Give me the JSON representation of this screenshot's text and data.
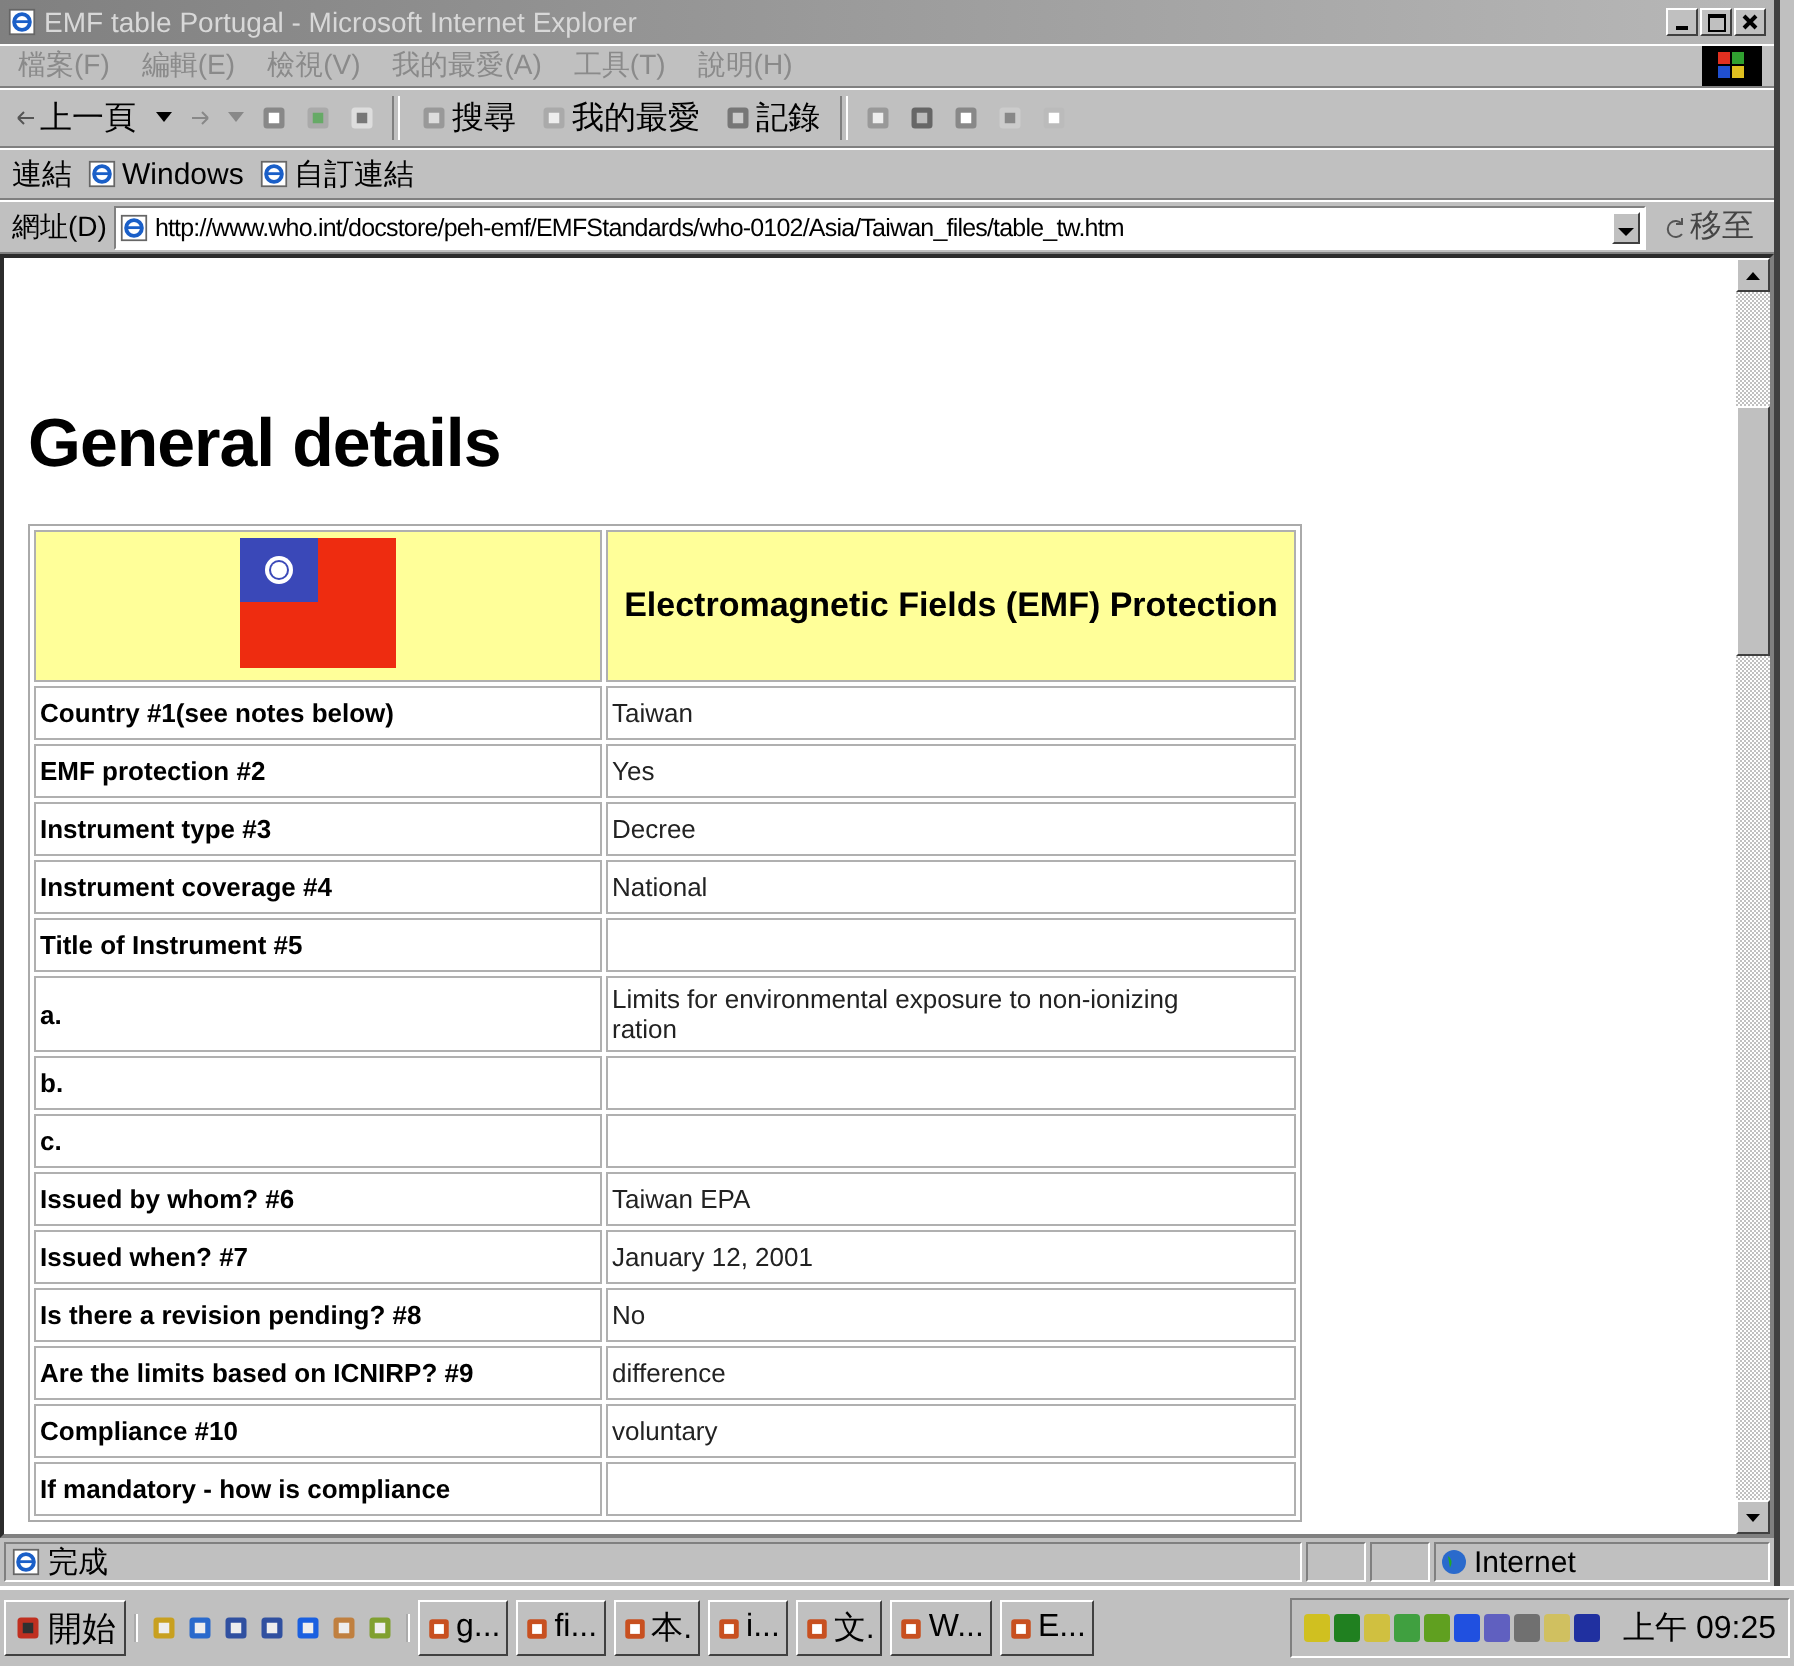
{
  "window": {
    "title": "EMF table Portugal - Microsoft Internet Explorer"
  },
  "menu": [
    "檔案(F)",
    "編輯(E)",
    "檢視(V)",
    "我的最愛(A)",
    "工具(T)",
    "說明(H)"
  ],
  "toolbar": {
    "back": "上一頁",
    "search": "搜尋",
    "favorites": "我的最愛",
    "history": "記錄"
  },
  "links_bar": {
    "label": "連結",
    "links": [
      "Windows",
      "自訂連結"
    ]
  },
  "address_bar": {
    "label": "網址(D)",
    "value": "http://www.who.int/docstore/peh-emf/EMFStandards/who-0102/Asia/Taiwan_files/table_tw.htm",
    "go": "移至"
  },
  "page": {
    "heading": "General details",
    "table_header": "Electromagnetic Fields (EMF) Protection",
    "rows": [
      {
        "label": "Country #1(see notes below)",
        "value": "Taiwan"
      },
      {
        "label": "EMF protection #2",
        "value": "Yes"
      },
      {
        "label": "Instrument type #3",
        "value": "Decree"
      },
      {
        "label": "Instrument coverage #4",
        "value": "National"
      },
      {
        "label": "Title of Instrument #5",
        "value": ""
      },
      {
        "label": "a.",
        "value": "Limits for environmental exposure to non-ionizing ration"
      },
      {
        "label": "b.",
        "value": ""
      },
      {
        "label": "c.",
        "value": ""
      },
      {
        "label": "Issued by whom? #6",
        "value": "Taiwan EPA"
      },
      {
        "label": "Issued when? #7",
        "value": "January 12, 2001"
      },
      {
        "label": "Is there a revision pending? #8",
        "value": "No"
      },
      {
        "label": "Are the limits based on ICNIRP? #9",
        "value": "difference"
      },
      {
        "label": "Compliance #10",
        "value": "voluntary"
      },
      {
        "label": "If mandatory - how is compliance",
        "value": ""
      }
    ]
  },
  "status_bar": {
    "text": "完成",
    "zone": "Internet"
  },
  "taskbar": {
    "start": "開始",
    "tasks": [
      "g...",
      "fi...",
      "本.",
      "i...",
      "文.",
      "W...",
      "E..."
    ],
    "clock": "上午 09:25"
  }
}
